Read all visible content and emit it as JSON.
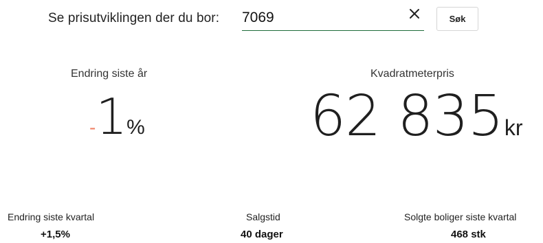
{
  "search": {
    "label": "Se prisutviklingen der du bor:",
    "value": "7069",
    "clear_icon": "close-icon",
    "button_label": "Søk",
    "accent_color": "#1e6b3a"
  },
  "year_change": {
    "title": "Endring siste år",
    "sign": "-",
    "value": "1",
    "unit": "%",
    "sign_color": "#f0856a"
  },
  "square_meter_price": {
    "title": "Kvadratmeterpris",
    "value": "62 835",
    "unit": "kr"
  },
  "quarter_change": {
    "title": "Endring siste kvartal",
    "value": "+1,5%"
  },
  "sales_time": {
    "title": "Salgstid",
    "value": "40 dager"
  },
  "sold_homes": {
    "title": "Solgte boliger siste kvartal",
    "value": "468 stk"
  }
}
